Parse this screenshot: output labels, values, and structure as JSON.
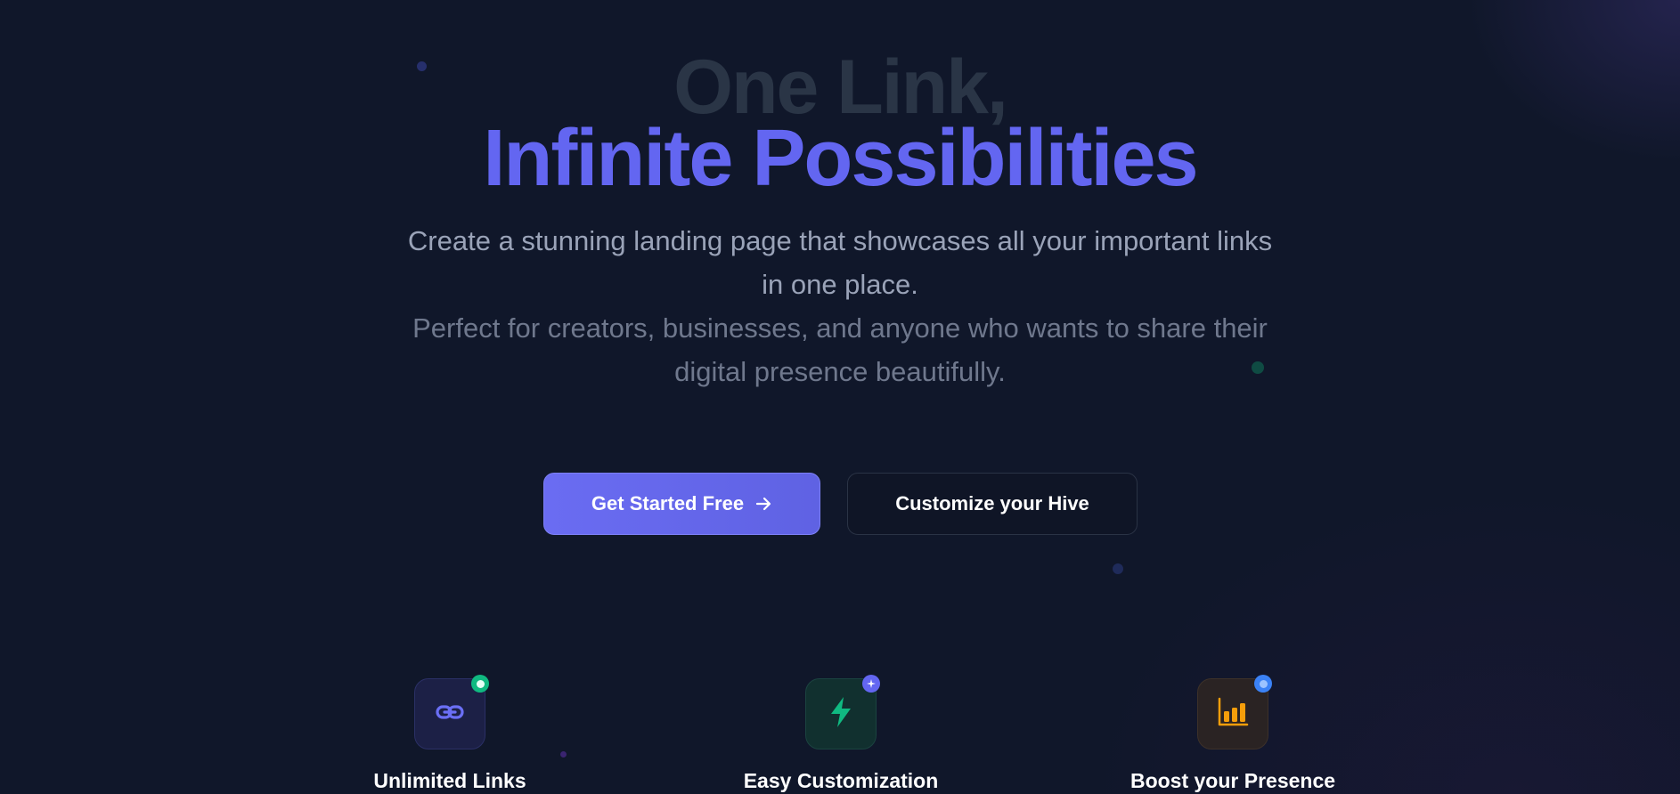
{
  "hero": {
    "title_line_1": "One Link,",
    "title_line_2": "Infinite Possibilities",
    "subtitle_1": "Create a stunning landing page that showcases all your important links in one place.",
    "subtitle_2": "Perfect for creators, businesses, and anyone who wants to share their digital presence beautifully."
  },
  "actions": {
    "primary_label": "Get Started Free",
    "primary_icon": "arrow-right-icon",
    "secondary_label": "Customize your Hive"
  },
  "features": [
    {
      "title": "Unlimited Links",
      "icon": "link-icon",
      "badge_icon": "dot-badge",
      "accent": "#6366f1",
      "badge_color": "#10b981"
    },
    {
      "title": "Easy Customization",
      "icon": "lightning-icon",
      "badge_icon": "sparkle-badge",
      "accent": "#10b981",
      "badge_color": "#6366f1"
    },
    {
      "title": "Boost your Presence",
      "icon": "bar-chart-icon",
      "badge_icon": "dot-badge",
      "accent": "#f59e0b",
      "badge_color": "#3b82f6"
    }
  ],
  "colors": {
    "background": "#10172a",
    "brand": "#6366f1",
    "muted_title": "#2a3546",
    "subtitle": "#9aa3b8"
  }
}
